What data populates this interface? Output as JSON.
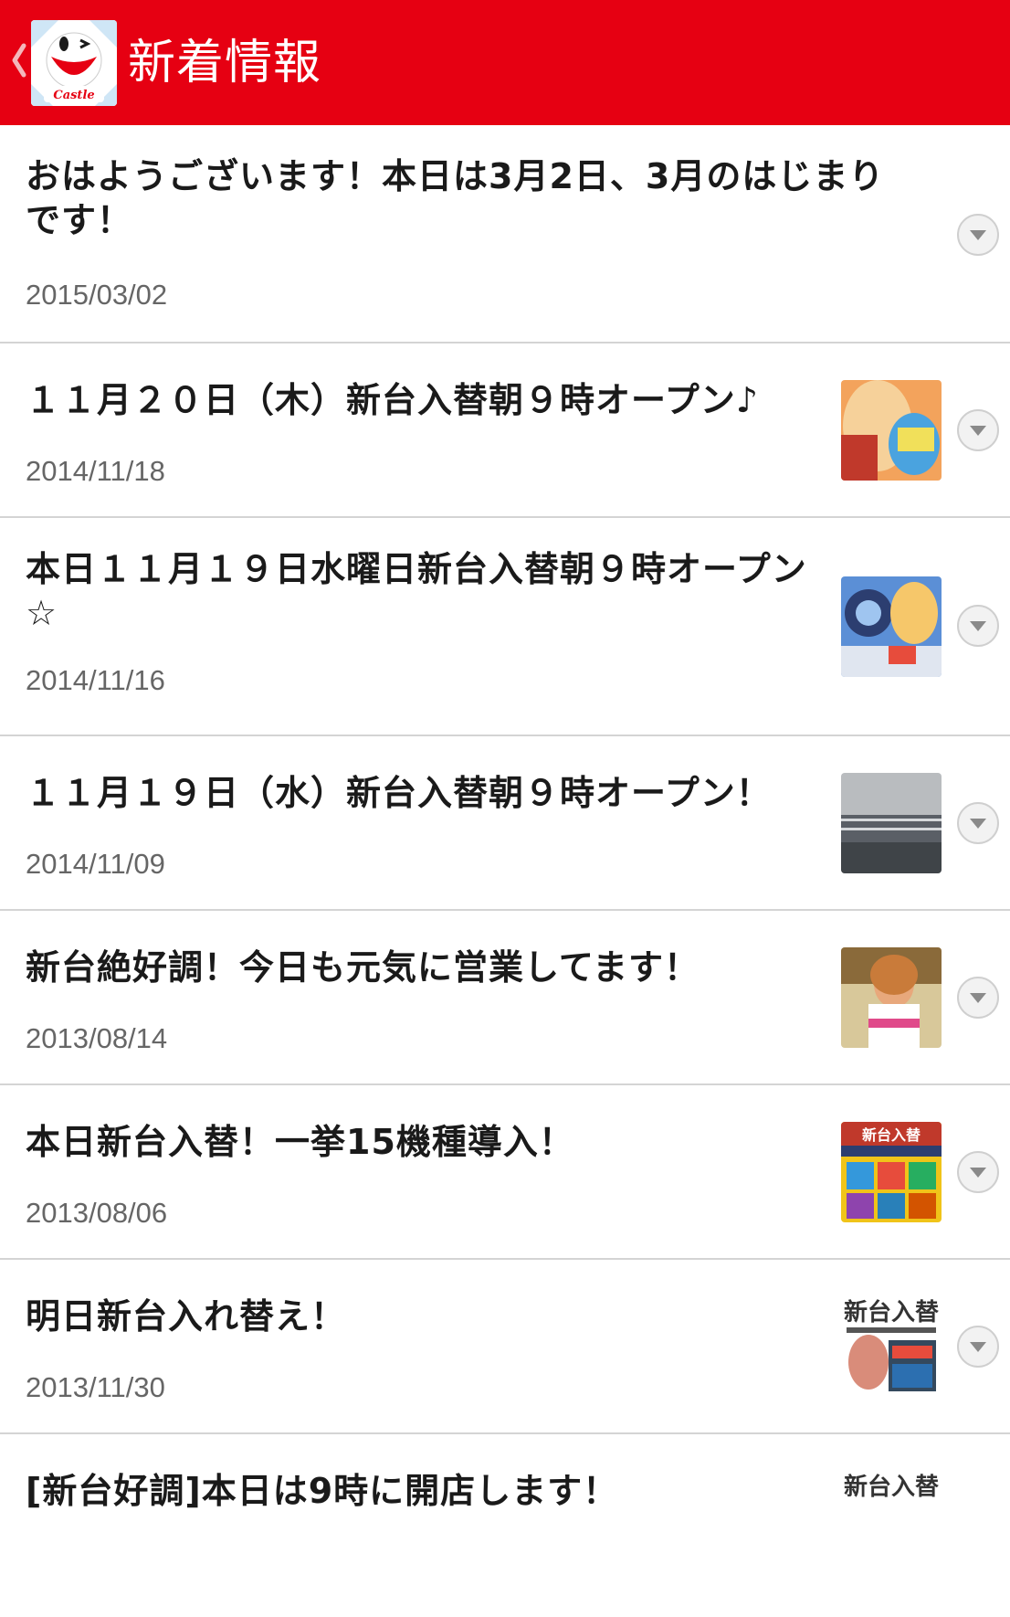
{
  "header": {
    "title": "新着情報",
    "logo_text": "Castle",
    "bar_color": "#e60012"
  },
  "news": [
    {
      "title": "おはようございます！本日は3月2日、3月のはじまりです！",
      "date": "2015/03/02",
      "has_thumbnail": false
    },
    {
      "title": "１１月２０日（木）新台入替朝９時オープン♪",
      "date": "2014/11/18",
      "has_thumbnail": true
    },
    {
      "title": "本日１１月１９日水曜日新台入替朝９時オープン☆",
      "date": "2014/11/16",
      "has_thumbnail": true
    },
    {
      "title": "１１月１９日（水）新台入替朝９時オープン！",
      "date": "2014/11/09",
      "has_thumbnail": true
    },
    {
      "title": "新台絶好調！今日も元気に営業してます！",
      "date": "2013/08/14",
      "has_thumbnail": true
    },
    {
      "title": "本日新台入替！一挙15機種導入！",
      "date": "2013/08/06",
      "has_thumbnail": true
    },
    {
      "title": "明日新台入れ替え！",
      "date": "2013/11/30",
      "has_thumbnail": true
    },
    {
      "title": "[新台好調]本日は9時に開店します！",
      "date": "",
      "has_thumbnail": true
    }
  ],
  "thumbnails": {
    "t1": {
      "text": ""
    },
    "t5": {
      "text": "新台入替"
    },
    "t6": {
      "text": "新台入替"
    },
    "t7": {
      "text": "新台入替"
    }
  }
}
